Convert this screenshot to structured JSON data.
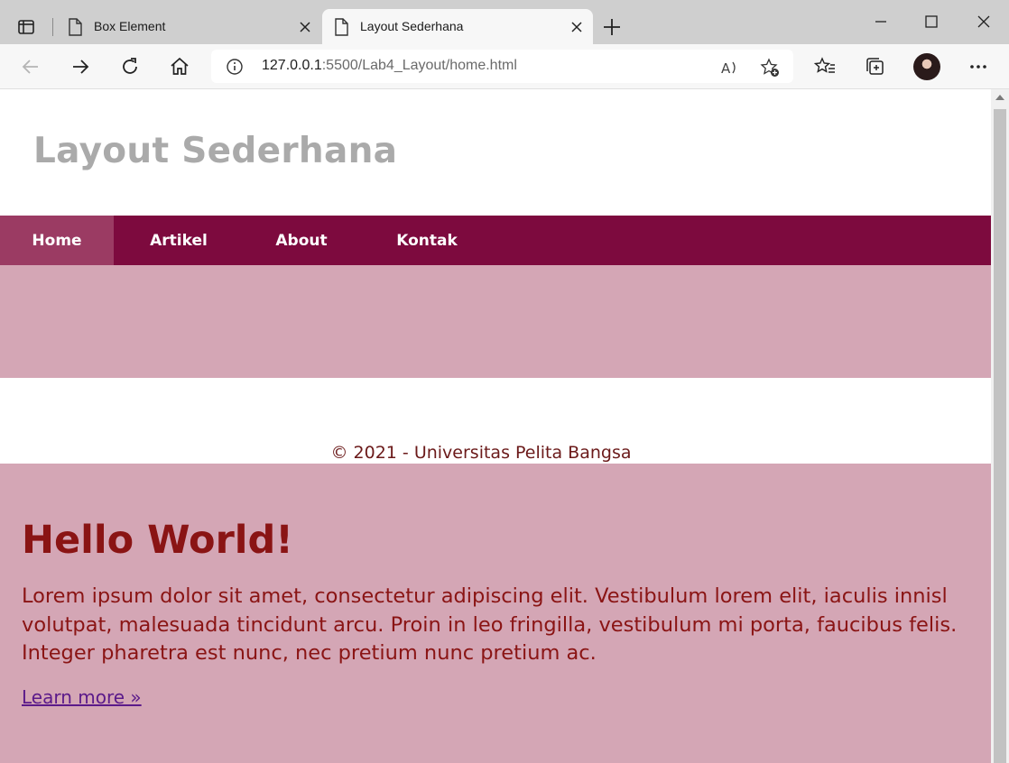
{
  "browser": {
    "tabs": [
      {
        "title": "Box Element",
        "active": false
      },
      {
        "title": "Layout Sederhana",
        "active": true
      }
    ],
    "url_host": "127.0.0.1",
    "url_rest": ":5500/Lab4_Layout/home.html"
  },
  "page": {
    "site_title": "Layout Sederhana",
    "nav": [
      {
        "label": "Home",
        "active": true
      },
      {
        "label": "Artikel",
        "active": false
      },
      {
        "label": "About",
        "active": false
      },
      {
        "label": "Kontak",
        "active": false
      }
    ],
    "footer": "© 2021 - Universitas Pelita Bangsa",
    "jumbotron": {
      "title": "Hello World!",
      "text": "Lorem ipsum dolor sit amet, consectetur adipiscing elit. Vestibulum lorem elit, iaculis innisl volutpat, malesuada tincidunt arcu. Proin in leo fringilla, vestibulum mi porta, faucibus felis. Integer pharetra est nunc, nec pretium nunc pretium ac.",
      "link": "Learn more »"
    }
  },
  "colors": {
    "nav_bg": "#7d0a3e",
    "nav_active_bg": "#9b3b63",
    "band_bg": "#d4a6b5",
    "heading_text": "#8a1414"
  }
}
